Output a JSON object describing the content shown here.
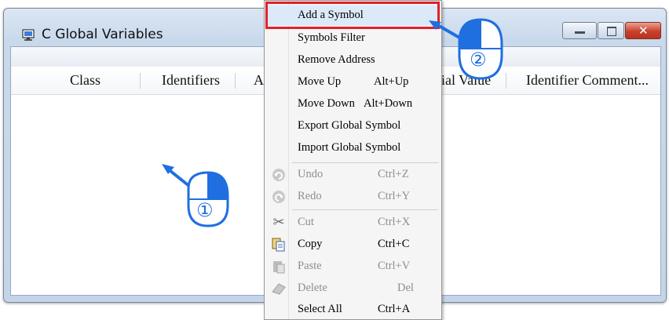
{
  "window": {
    "title": "C Global Variables"
  },
  "table": {
    "columns": [
      "Class",
      "Identifiers",
      "A",
      "ial Value",
      "Identifier Comment..."
    ]
  },
  "context_menu": {
    "items": [
      {
        "label": "Add a Symbol",
        "shortcut": ""
      },
      {
        "label": "Symbols Filter",
        "shortcut": ""
      },
      {
        "label": "Remove Address",
        "shortcut": ""
      },
      {
        "label": "Move Up",
        "shortcut": "Alt+Up"
      },
      {
        "label": "Move Down",
        "shortcut": "Alt+Down"
      },
      {
        "label": "Export Global Symbol",
        "shortcut": ""
      },
      {
        "label": "Import Global Symbol",
        "shortcut": ""
      },
      {
        "label": "Undo",
        "shortcut": "Ctrl+Z",
        "icon": "undo-icon",
        "disabled": true
      },
      {
        "label": "Redo",
        "shortcut": "Ctrl+Y",
        "icon": "redo-icon",
        "disabled": true
      },
      {
        "label": "Cut",
        "shortcut": "Ctrl+X",
        "icon": "cut-icon",
        "disabled": true
      },
      {
        "label": "Copy",
        "shortcut": "Ctrl+C",
        "icon": "copy-icon"
      },
      {
        "label": "Paste",
        "shortcut": "Ctrl+V",
        "icon": "paste-icon",
        "disabled": true
      },
      {
        "label": "Delete",
        "shortcut": "Del",
        "icon": "delete-icon",
        "disabled": true
      },
      {
        "label": "Select All",
        "shortcut": "Ctrl+A"
      }
    ]
  },
  "callouts": [
    {
      "number": "①",
      "note": "right-click in table area"
    },
    {
      "number": "②",
      "note": "click Add a Symbol"
    }
  ],
  "colors": {
    "highlight_box": "#e2202a",
    "callout_blue": "#1f6fe0",
    "menu_highlight": "#dce9f8"
  }
}
